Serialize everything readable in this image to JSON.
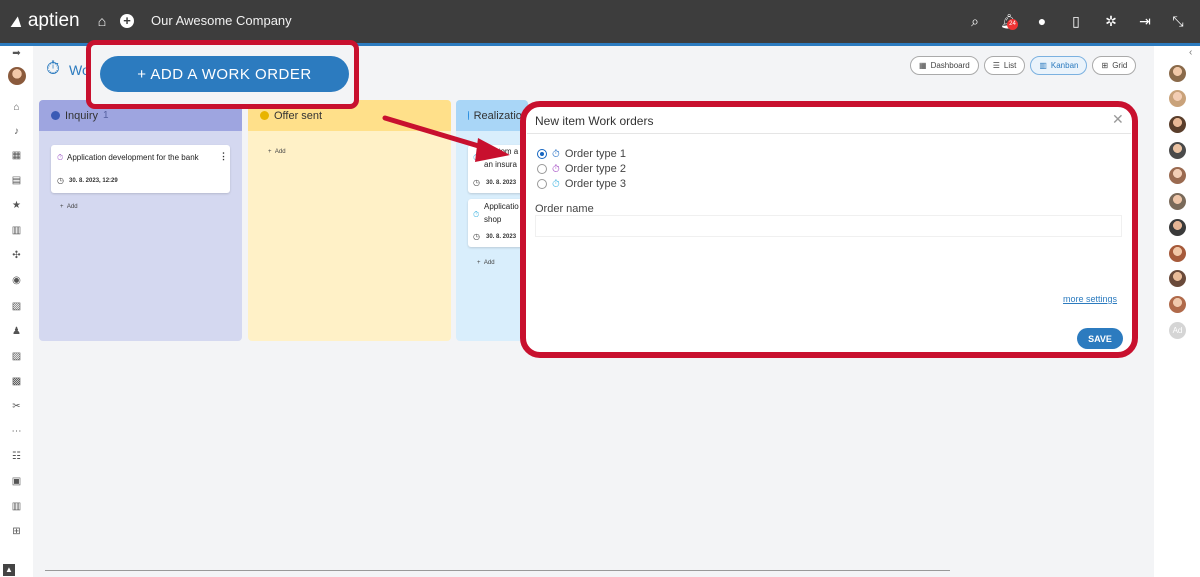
{
  "app": {
    "logo_text": "aptien",
    "company": "Our Awesome Company",
    "notification_count": "24"
  },
  "page": {
    "title": "Wo"
  },
  "views": [
    {
      "label": "Dashboard",
      "icon": "dashboard-icon",
      "active": false
    },
    {
      "label": "List",
      "icon": "list-icon",
      "active": false
    },
    {
      "label": "Kanban",
      "icon": "kanban-icon",
      "active": true
    },
    {
      "label": "Grid",
      "icon": "grid-icon",
      "active": false
    }
  ],
  "columns": [
    {
      "name": "Inquiry",
      "count": "1",
      "dot_color": "#3b5bb5",
      "bg": "#d4d8f0",
      "head_bg": "#9ea5e0",
      "cards": [
        {
          "title": "Application development for the bank",
          "date": "30. 8. 2023, 12:29"
        }
      ],
      "add_label": "Add"
    },
    {
      "name": "Offer sent",
      "dot_color": "#e8b400",
      "bg": "#fff1c7",
      "head_bg": "#ffe08a",
      "cards": [],
      "add_label": "Add"
    },
    {
      "name": "Realization",
      "dot_color": "#2c8fe0",
      "bg": "#d9eefc",
      "head_bg": "#a9d6f7",
      "cards": [
        {
          "title_line1": "Custom a",
          "title_line2": "an insura",
          "date": "30. 8. 2023"
        },
        {
          "title_line1": "Applicatio",
          "title_line2": "shop",
          "date": "30. 8. 2023"
        }
      ],
      "add_label": "Add"
    }
  ],
  "callout": {
    "button_label": "+ ADD A WORK ORDER"
  },
  "modal": {
    "title": "New item Work orders",
    "options": [
      {
        "label": "Order type 1",
        "checked": true,
        "icon": "timer-icon",
        "icon_color": "#1565c0"
      },
      {
        "label": "Order type 2",
        "checked": false,
        "icon": "timer-icon",
        "icon_color": "#9c3fbf"
      },
      {
        "label": "Order type 3",
        "checked": false,
        "icon": "timer-icon",
        "icon_color": "#3bb2e0"
      }
    ],
    "field_label": "Order name",
    "field_value": "",
    "more_settings": "more settings",
    "save_label": "SAVE"
  },
  "right_sidebar": {
    "ad_label": "Ad"
  },
  "colors": {
    "accent": "#2c7bbf",
    "highlight": "#c8102e",
    "topbar": "#3d3d3d"
  }
}
